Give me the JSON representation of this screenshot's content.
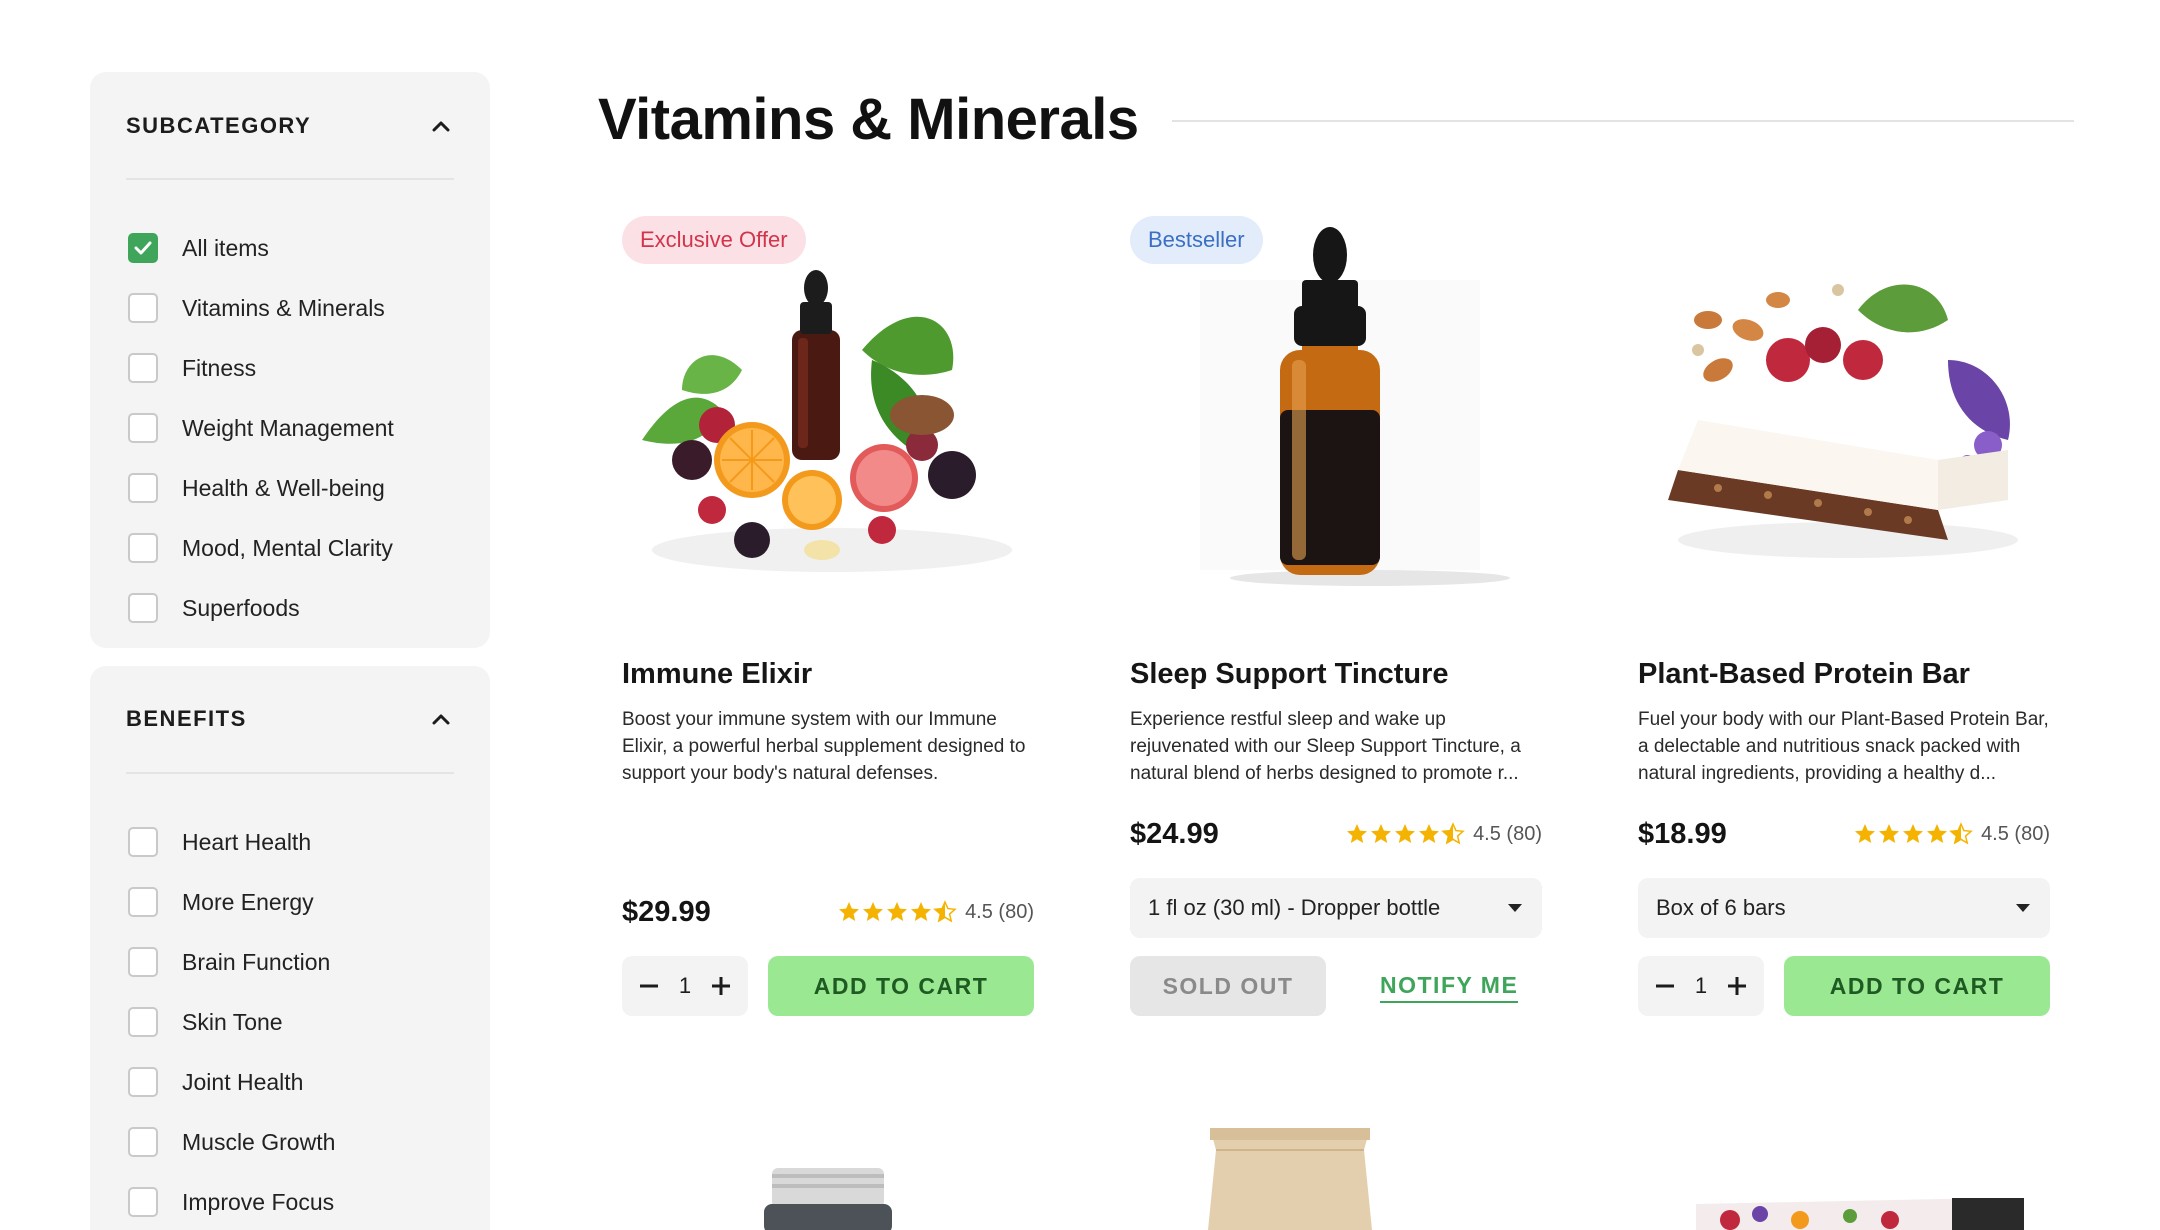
{
  "sidebar": {
    "subcategory": {
      "title": "SUBCATEGORY",
      "options": [
        {
          "label": "All items",
          "checked": true
        },
        {
          "label": "Vitamins & Minerals",
          "checked": false
        },
        {
          "label": "Fitness",
          "checked": false
        },
        {
          "label": "Weight Management",
          "checked": false
        },
        {
          "label": "Health & Well-being",
          "checked": false
        },
        {
          "label": "Mood, Mental Clarity",
          "checked": false
        },
        {
          "label": "Superfoods",
          "checked": false
        }
      ]
    },
    "benefits": {
      "title": "BENEFITS",
      "options": [
        {
          "label": "Heart Health",
          "checked": false
        },
        {
          "label": "More Energy",
          "checked": false
        },
        {
          "label": "Brain Function",
          "checked": false
        },
        {
          "label": "Skin Tone",
          "checked": false
        },
        {
          "label": "Joint Health",
          "checked": false
        },
        {
          "label": "Muscle Growth",
          "checked": false
        },
        {
          "label": "Improve Focus",
          "checked": false
        }
      ]
    }
  },
  "page": {
    "title": "Vitamins & Minerals"
  },
  "products": [
    {
      "badge": "Exclusive Offer",
      "name": "Immune Elixir",
      "description": "Boost your immune system with our Immune Elixir, a powerful herbal supplement designed to support your body's natural defenses.",
      "price": "$29.99",
      "rating": 4.5,
      "rating_text": "4.5 (80)",
      "quantity": "1",
      "action": "ADD TO CART"
    },
    {
      "badge": "Bestseller",
      "name": "Sleep Support Tincture",
      "description": "Experience restful sleep and wake up rejuvenated with our Sleep Support Tincture, a natural blend of herbs designed to promote r...",
      "price": "$24.99",
      "rating": 4.5,
      "rating_text": "4.5 (80)",
      "variant": "1 fl oz (30 ml) - Dropper bottle",
      "status": "SOLD OUT",
      "secondary_action": "NOTIFY ME"
    },
    {
      "name": "Plant-Based Protein Bar",
      "description": "Fuel your body with our Plant-Based Protein Bar, a delectable and nutritious snack packed with natural ingredients, providing a healthy d...",
      "price": "$18.99",
      "rating": 4.5,
      "rating_text": "4.5 (80)",
      "variant": "Box of 6 bars",
      "quantity": "1",
      "action": "ADD TO CART"
    }
  ],
  "colors": {
    "accent_green": "#3ea55a",
    "add_button_bg": "#9be893",
    "star": "#f5b301",
    "exclusive_badge_text": "#d2344c",
    "bestseller_badge_text": "#3b6fc4"
  }
}
